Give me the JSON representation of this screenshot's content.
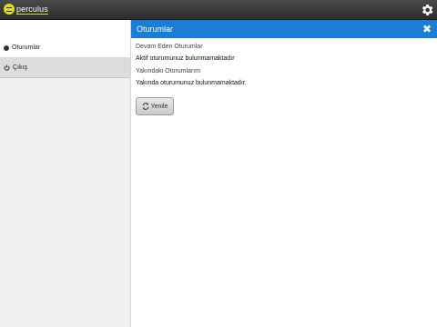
{
  "app": {
    "logo_text": "perculus"
  },
  "sidebar": {
    "items": [
      {
        "label": "Oturumlar",
        "icon": "bullet-icon",
        "active": true
      },
      {
        "label": "Çıkış",
        "icon": "power-icon",
        "active": false
      }
    ]
  },
  "panel": {
    "title": "Oturumlar",
    "close_label": "✖"
  },
  "sections": {
    "ongoing": {
      "label": "Devam Eden Oturumlar",
      "value": "Aktif oturumunuz bulunmamaktadır"
    },
    "upcoming": {
      "label": "Yakındaki Oturumlarım",
      "value": "Yakında oturumunuz bulunmamaktadır."
    }
  },
  "actions": {
    "refresh_label": "Yenile"
  },
  "colors": {
    "accent": "#1a7ed6",
    "topbar": "#3a3a3a",
    "logo": "#d6e021"
  }
}
